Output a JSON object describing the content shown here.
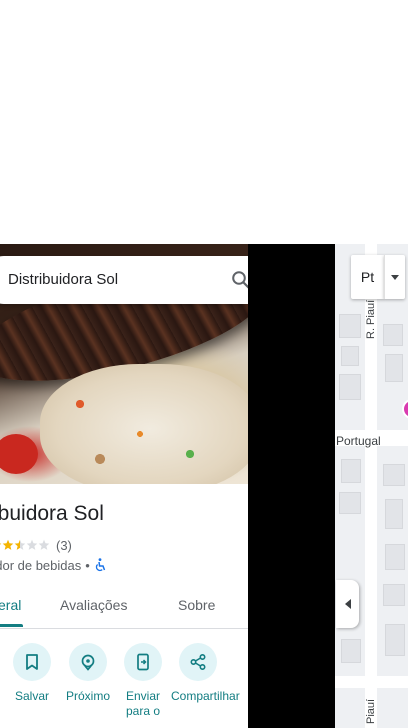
{
  "search": {
    "value": "Distribuidora Sol",
    "placeholder": ""
  },
  "place": {
    "title": "ibuidora Sol",
    "rating_count": "(3)",
    "stars": [
      1,
      1,
      0.5,
      0,
      0
    ],
    "category": "edor de bebidas",
    "separator": "•"
  },
  "tabs": [
    {
      "label": "eral",
      "active": true
    },
    {
      "label": "Avaliações",
      "active": false
    },
    {
      "label": "Sobre",
      "active": false
    }
  ],
  "actions": [
    {
      "label": "Salvar",
      "icon": "bookmark-icon"
    },
    {
      "label": "Próximo",
      "icon": "nearby-icon"
    },
    {
      "label": "Enviar para o",
      "icon": "send-to-phone-icon"
    },
    {
      "label": "Compartilhar",
      "icon": "share-icon"
    }
  ],
  "map": {
    "street_vertical": "R. Piauí",
    "street_vertical_lower": "Piauí",
    "street_horizontal": "Portugal",
    "layer_button": "Pt"
  },
  "colors": {
    "accent": "#137d82",
    "accent_light": "#e1f4f7",
    "star": "#f4b400",
    "pin": "#d93bb0"
  }
}
